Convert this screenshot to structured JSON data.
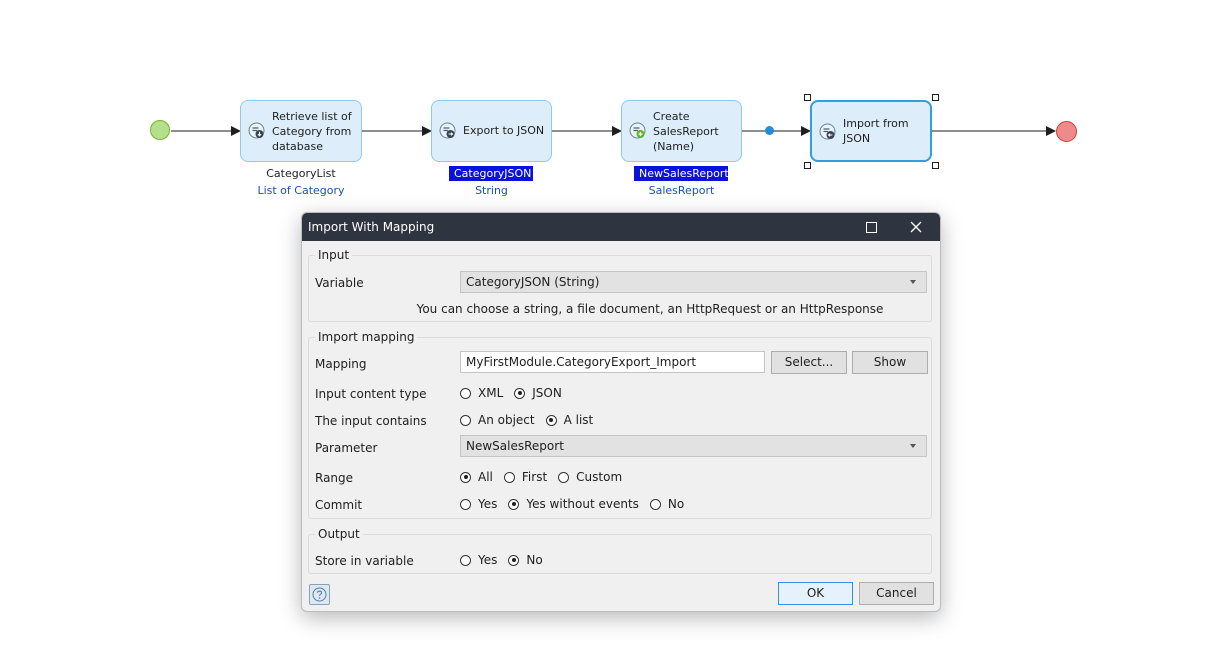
{
  "microflow": {
    "activities": [
      {
        "id": "retrieve",
        "label": "Retrieve list of Category from database",
        "output_name": "CategoryList",
        "output_type": "List of Category",
        "output_highlighted": false
      },
      {
        "id": "export",
        "label": "Export to JSON",
        "output_name": "CategoryJSON",
        "output_type": "String",
        "output_highlighted": true
      },
      {
        "id": "create",
        "label": "Create SalesReport (Name)",
        "output_name": "NewSalesReport",
        "output_type": "SalesReport",
        "output_highlighted": true
      },
      {
        "id": "import",
        "label": "Import from JSON",
        "output_name": "",
        "output_type": "",
        "output_highlighted": false,
        "selected": true
      }
    ],
    "labels": {
      "retrieve": "Retrieve list of Category from database",
      "export": "Export to JSON",
      "create": "Create SalesReport (Name)",
      "import": "Import from JSON"
    },
    "outputs": {
      "retrieve_name": "CategoryList",
      "retrieve_type": "List of Category",
      "export_name": "CategoryJSON",
      "export_type": "String",
      "create_name": "NewSalesReport",
      "create_type": "SalesReport"
    },
    "colors": {
      "start": "#b5e08a",
      "end": "#f08a8a",
      "activity": "#ddeefa",
      "selected_border": "#2f9fe0",
      "highlight": "#0a12d8"
    }
  },
  "dialog": {
    "title": "Import With Mapping",
    "maximize_icon": "maximize-icon",
    "close_icon": "close-icon",
    "input": {
      "group_title": "Input",
      "variable_label": "Variable",
      "variable_value": "CategoryJSON (String)",
      "hint": "You can choose a string, a file document, an HttpRequest or an HttpResponse"
    },
    "import_mapping": {
      "group_title": "Import mapping",
      "mapping_label": "Mapping",
      "mapping_value": "MyFirstModule.CategoryExport_Import",
      "select_button": "Select...",
      "show_button": "Show",
      "content_type_label": "Input content type",
      "content_type_options": [
        "XML",
        "JSON"
      ],
      "content_type_selected": "JSON",
      "contains_label": "The input contains",
      "contains_options": [
        "An object",
        "A list"
      ],
      "contains_selected": "A list",
      "parameter_label": "Parameter",
      "parameter_value": "NewSalesReport",
      "range_label": "Range",
      "range_options": [
        "All",
        "First",
        "Custom"
      ],
      "range_selected": "All",
      "commit_label": "Commit",
      "commit_options": [
        "Yes",
        "Yes without events",
        "No"
      ],
      "commit_selected": "Yes without events"
    },
    "output": {
      "group_title": "Output",
      "store_label": "Store in variable",
      "store_options": [
        "Yes",
        "No"
      ],
      "store_selected": "No"
    },
    "ok_button": "OK",
    "cancel_button": "Cancel",
    "help_icon": "help-icon"
  }
}
